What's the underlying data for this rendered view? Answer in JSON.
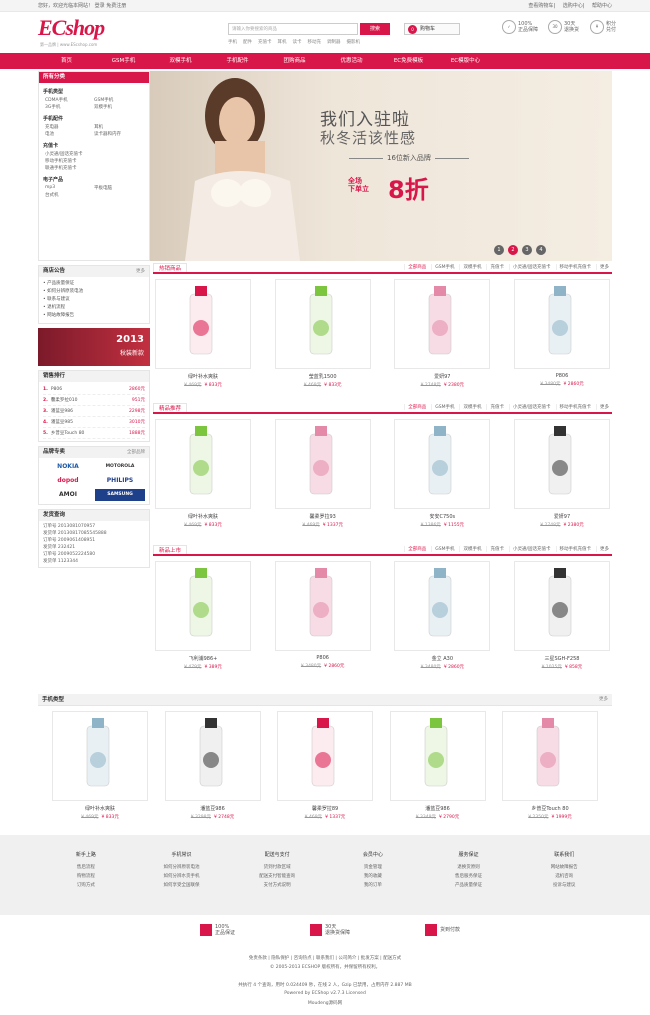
{
  "topbar": {
    "welcome": "您好，欢迎光临本网站！",
    "login": "登录",
    "register": "免费注册",
    "links": [
      "查看购物车",
      "选购中心",
      "帮助中心"
    ]
  },
  "header": {
    "logo": "ECshop",
    "logo_sub": "第一品牌 | www.EScshop.com",
    "search_placeholder": "请输入你要搜索的商品",
    "search_btn": "搜索",
    "cart_label": "购物车",
    "cart_count": "0",
    "hot_keywords": [
      "手机",
      "配件",
      "充值卡",
      "耳机",
      "读卡",
      "移动充",
      "调制器",
      "摄影机"
    ],
    "services": [
      {
        "big": "100%",
        "label": "正品保障"
      },
      {
        "big": "30天",
        "label": "退换货"
      },
      {
        "big": "积分",
        "label": "兑付"
      }
    ]
  },
  "nav": [
    "首页",
    "GSM手机",
    "双模手机",
    "手机配件",
    "团购商品",
    "优惠活动",
    "EC免费模板",
    "EC模版中心"
  ],
  "categories": {
    "title": "所有分类",
    "groups": [
      {
        "name": "手机类型",
        "items": [
          "CDMA手机",
          "GSM手机",
          "3G手机",
          "双模手机"
        ]
      },
      {
        "name": "手机配件",
        "items": [
          "充电器",
          "耳机",
          "电池",
          "读卡器和内存"
        ]
      },
      {
        "name": "充值卡",
        "items": [
          "小灵通/固话充值卡",
          "移动手机充值卡",
          "联通手机充值卡"
        ]
      },
      {
        "name": "电子产品",
        "items": [
          "mp3",
          "平板电脑",
          "台式机"
        ]
      }
    ]
  },
  "banner": {
    "line1": "我们入驻啦",
    "line2": "秋冬活该性感",
    "line3": "16位新入品牌",
    "tag": "全场\n下单立",
    "discount": "8折",
    "dots": [
      "1",
      "2",
      "3",
      "4"
    ]
  },
  "notice": {
    "title": "商店公告",
    "more": "更多",
    "items": [
      "产品质量保证",
      "如何分辨原装电池",
      "联系与建议",
      "退机流程",
      "网站故障报告"
    ]
  },
  "promo": {
    "year": "2013",
    "text": "秋装新款"
  },
  "ranking": {
    "title": "销售排行",
    "items": [
      {
        "n": "1.",
        "name": "P806",
        "price": "2860元"
      },
      {
        "n": "2.",
        "name": "馨柔罗拉010",
        "price": "951元"
      },
      {
        "n": "3.",
        "name": "潘蓝豆986",
        "price": "2298元"
      },
      {
        "n": "4.",
        "name": "潘蓝豆985",
        "price": "3010元"
      },
      {
        "n": "5.",
        "name": "乡普豆Touch 80",
        "price": "1888元"
      }
    ]
  },
  "brands": {
    "title": "品牌专卖",
    "more": "全部品牌",
    "items": [
      "NOKIA",
      "MOTOROLA",
      "dopod",
      "PHILIPS",
      "AMOI",
      "SAMSUNG"
    ]
  },
  "contact": {
    "title": "发货查询",
    "rows": [
      "订单号 2013081070957",
      "发货单 20130817085545888",
      "订单号 2009061408951",
      "发货单 232421",
      "订单号 2009052224580",
      "发货单 1123344"
    ]
  },
  "tabs": [
    "全部商品",
    "GSM手机",
    "双模手机",
    "充值卡",
    "小灵通/固话充值卡",
    "移动手机充值卡",
    "更多"
  ],
  "hot": {
    "title": "热销商品",
    "items": [
      {
        "name": "绿叶补水爽肤",
        "old": "¥ 469元",
        "new": "¥ 833元"
      },
      {
        "name": "莹蓝乳1500",
        "old": "¥ 469元",
        "new": "¥ 833元"
      },
      {
        "name": "爱妍97",
        "old": "¥ 2748元",
        "new": "¥ 2380元"
      },
      {
        "name": "P806",
        "old": "¥ 3480元",
        "new": "¥ 2860元"
      }
    ]
  },
  "best": {
    "title": "精品推荐",
    "items": [
      {
        "name": "绿叶补水爽肤",
        "old": "¥ 469元",
        "new": "¥ 833元"
      },
      {
        "name": "馨柔罗拉93",
        "old": "¥ 469元",
        "new": "¥ 1337元"
      },
      {
        "name": "安安C750s",
        "old": "¥ 1386元",
        "new": "¥ 1155元"
      },
      {
        "name": "爱妍97",
        "old": "¥ 2748元",
        "new": "¥ 2380元"
      }
    ]
  },
  "newp": {
    "title": "新品上市",
    "items": [
      {
        "name": "飞利浦986+",
        "old": "¥ 479元",
        "new": "¥ 389元"
      },
      {
        "name": "P806",
        "old": "¥ 3480元",
        "new": "¥ 2860元"
      },
      {
        "name": "金立 A30",
        "old": "¥ 3480元",
        "new": "¥ 2860元"
      },
      {
        "name": "三星SGH-F258",
        "old": "¥ 1025元",
        "new": "¥ 858元"
      }
    ]
  },
  "phones": {
    "title": "手机类型",
    "more": "更多",
    "items": [
      {
        "name": "绿叶补水爽肤",
        "old": "¥ 469元",
        "new": "¥ 833元"
      },
      {
        "name": "潘蓝豆986",
        "old": "¥ 3298元",
        "new": "¥ 2748元"
      },
      {
        "name": "馨柔罗拉89",
        "old": "¥ 469元",
        "new": "¥ 1337元"
      },
      {
        "name": "潘蓝豆986",
        "old": "¥ 3349元",
        "new": "¥ 2790元"
      },
      {
        "name": "乡普豆Touch 80",
        "old": "¥ 2350元",
        "new": "¥ 1999元"
      }
    ]
  },
  "footer": {
    "cols": [
      {
        "h": "新手上路",
        "items": [
          "售后流程",
          "购物流程",
          "订购方式"
        ]
      },
      {
        "h": "手机常识",
        "items": [
          "如何分辨原装电池",
          "如何分辨水货手机",
          "如何享受全国联保"
        ]
      },
      {
        "h": "配送与支付",
        "items": [
          "货到付款区域",
          "配送支付智能查询",
          "支付方式说明"
        ]
      },
      {
        "h": "会员中心",
        "items": [
          "资金管理",
          "我的收藏",
          "我的订单"
        ]
      },
      {
        "h": "服务保证",
        "items": [
          "退换货原则",
          "售后服务保证",
          "产品质量保证"
        ]
      },
      {
        "h": "联系我们",
        "items": [
          "网站故障报告",
          "选机咨询",
          "投诉与建议"
        ]
      }
    ],
    "guarantee": [
      {
        "big": "100%",
        "small": "正品保证"
      },
      {
        "big": "30天",
        "small": "退换货保障"
      },
      {
        "big": "货到付款",
        "small": ""
      }
    ],
    "links": "免责条款 | 隐私保护 | 咨询热点 | 联系我们 | 公司简介 | 批发方案 | 配送方式",
    "copyright": "© 2005-2013 ECSHOP 版权所有，并保留所有权利。",
    "stats": "共执行 4 个查询，用时 0.024409 秒，在线 2 人，Gzip 已禁用，占用内存 2.887 MB",
    "powered": "Powered by ECShop v2.7.3   Licensed",
    "site": "Moudeng源码网"
  }
}
